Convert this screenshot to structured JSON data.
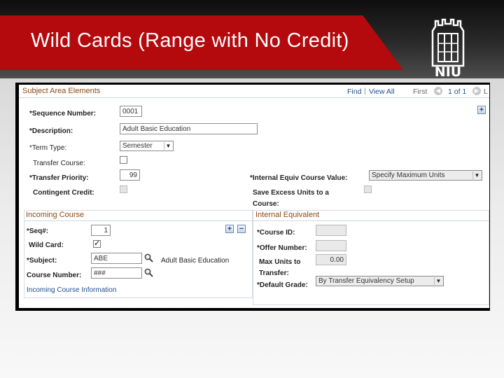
{
  "slide": {
    "title": "Wild Cards (Range with No Credit)",
    "logo_text": "NIU"
  },
  "subject_area": {
    "title": "Subject Area Elements",
    "nav": {
      "find": "Find",
      "view_all": "View All",
      "first": "First",
      "page": "1 of 1",
      "last": "L"
    },
    "sequence_number": {
      "label": "*Sequence Number:",
      "value": "0001"
    },
    "description": {
      "label": "*Description:",
      "value": "Adult Basic Education"
    },
    "term_type": {
      "label": "*Term Type:",
      "value": "Semester"
    },
    "transfer_course": {
      "label": "Transfer Course:",
      "checked": false
    },
    "transfer_priority": {
      "label": "*Transfer Priority:",
      "value": "99"
    },
    "contingent_credit": {
      "label": "Contingent Credit:",
      "checked": false
    },
    "internal_equiv_course_value": {
      "label": "*Internal Equiv Course Value:",
      "value": "Specify Maximum Units"
    },
    "save_excess_units": {
      "label_line1": "Save Excess Units to a",
      "label_line2": "Course:",
      "checked": false
    }
  },
  "incoming_course": {
    "title": "Incoming Course",
    "seq": {
      "label": "*Seq#:",
      "value": "1"
    },
    "wildcard": {
      "label": "Wild Card:",
      "checked": true,
      "mark": "✓"
    },
    "subject": {
      "label": "*Subject:",
      "value": "ABE",
      "description": "Adult Basic Education"
    },
    "course_number": {
      "label": "Course Number:",
      "value": "###"
    },
    "info_link": "Incoming Course Information"
  },
  "internal_equivalent": {
    "title": "Internal Equivalent",
    "course_id": {
      "label": "*Course ID:",
      "value": ""
    },
    "offer_number": {
      "label": "*Offer Number:",
      "value": ""
    },
    "max_units": {
      "label_line1": "Max Units to",
      "label_line2": "Transfer:",
      "value": "0.00"
    },
    "default_grade": {
      "label": "*Default Grade:",
      "value": "By Transfer Equivalency Setup"
    }
  },
  "colors": {
    "banner_red": "#b4090d",
    "section_title": "#8b4a14",
    "link": "#244f8f"
  },
  "icons": [
    "lookup-icon",
    "add-row-icon",
    "delete-row-icon",
    "first-arrow-icon",
    "next-arrow-icon",
    "dropdown-arrow-icon"
  ]
}
